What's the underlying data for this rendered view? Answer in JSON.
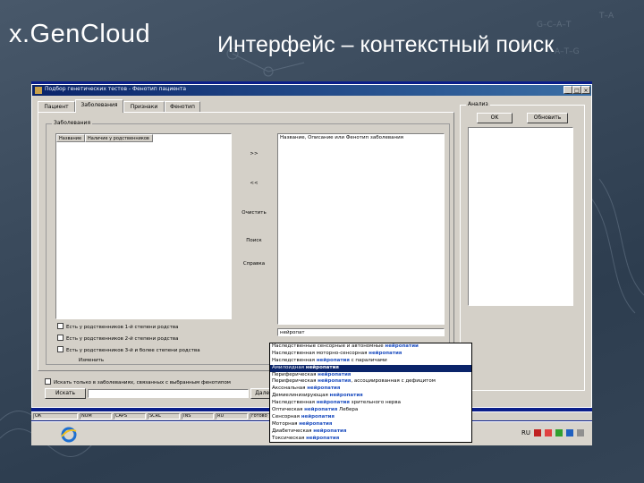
{
  "slide": {
    "logo": "x.GenCloud",
    "title": "Интерфейс – контекстный поиск"
  },
  "window": {
    "title": "Подбор генетических тестов - Фенотип пациента",
    "min": "_",
    "max": "□",
    "close": "×"
  },
  "tabs": [
    {
      "label": "Пациент"
    },
    {
      "label": "Заболевания"
    },
    {
      "label": "Признаки"
    },
    {
      "label": "Фенотип"
    }
  ],
  "diseases_group": {
    "label": "Заболевания",
    "columns": [
      "Название",
      "Наличие у родственников"
    ]
  },
  "middle_buttons": [
    ">>",
    "<<",
    "Очистить",
    "Поиск",
    "Справка"
  ],
  "search_results": {
    "header": "Название, Описание или Фенотип заболевания",
    "query": "нейропат"
  },
  "checkboxes": [
    "Есть у родственников 1-й степени родства",
    "Есть у родственников 2-й степени родства",
    "Есть у родственников 3-й и более степени родства"
  ],
  "change_link": "Изменить",
  "bottom_bar": {
    "checkbox_label": "Искать только в заболеваниях, связанных с выбранным фенотипом",
    "search_button": "Искать",
    "next_button": "Далее"
  },
  "right_panel": {
    "label": "Анализ",
    "btn_ok": "OK",
    "btn_update": "Обновить"
  },
  "dropdown": {
    "selected_index": 3,
    "items": [
      {
        "pre": "Наследственные сенсорные и автономные ",
        "hl": "нейропатии",
        "post": ""
      },
      {
        "pre": "Наследственная моторно-сенсорная ",
        "hl": "нейропатия",
        "post": ""
      },
      {
        "pre": "Наследственная ",
        "hl": "нейропатия",
        "post": " с параличами"
      },
      {
        "pre": "Амилоидная ",
        "hl": "нейропатия",
        "post": ""
      },
      {
        "pre": "Периферическая ",
        "hl": "нейропатия",
        "post": ""
      },
      {
        "pre": "Периферическая ",
        "hl": "нейропатия",
        "post": ", ассоциированная с дефицитом"
      },
      {
        "pre": "Аксональная ",
        "hl": "нейропатия",
        "post": ""
      },
      {
        "pre": "Демиелинизирующая ",
        "hl": "нейропатия",
        "post": ""
      },
      {
        "pre": "Наследственная ",
        "hl": "нейропатия",
        "post": " зрительного нерва"
      },
      {
        "pre": "Оптическая ",
        "hl": "нейропатия",
        "post": " Лебера"
      },
      {
        "pre": "Сенсорная ",
        "hl": "нейропатия",
        "post": ""
      },
      {
        "pre": "Моторная ",
        "hl": "нейропатия",
        "post": ""
      },
      {
        "pre": "Диабетическая ",
        "hl": "нейропатия",
        "post": ""
      },
      {
        "pre": "Токсическая ",
        "hl": "нейропатия",
        "post": ""
      }
    ]
  },
  "statusbar": {
    "cells": [
      "ОК",
      "NUM",
      "CAPS",
      "SCRL",
      "INS",
      "RU",
      "готово"
    ]
  },
  "tray": {
    "lang": "RU"
  }
}
